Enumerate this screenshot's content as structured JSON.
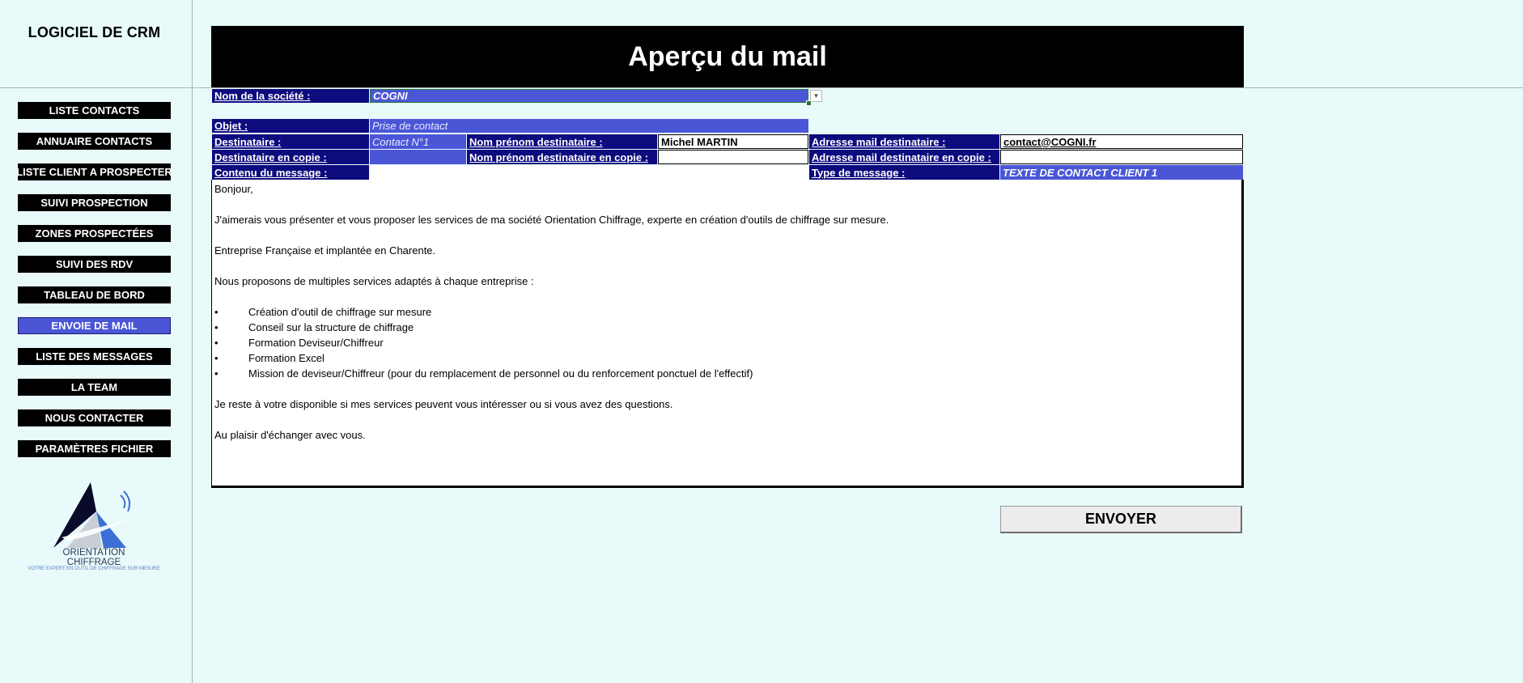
{
  "sidebar": {
    "title": "LOGICIEL DE CRM",
    "items": [
      {
        "label": "LISTE CONTACTS"
      },
      {
        "label": "ANNUAIRE CONTACTS"
      },
      {
        "label": "LISTE CLIENT A PROSPECTER"
      },
      {
        "label": "SUIVI PROSPECTION"
      },
      {
        "label": "ZONES PROSPECTÉES"
      },
      {
        "label": "SUIVI DES RDV"
      },
      {
        "label": "TABLEAU DE BORD"
      },
      {
        "label": "ENVOIE DE MAIL"
      },
      {
        "label": "LISTE DES MESSAGES"
      },
      {
        "label": "LA TEAM"
      },
      {
        "label": "NOUS CONTACTER"
      },
      {
        "label": "PARAMÈTRES FICHIER"
      }
    ],
    "logo": {
      "line1": "ORIENTATION",
      "line2": "CHIFFRAGE",
      "tagline": "VOTRE EXPERT EN OUTIL DE CHIFFRAGE SUR MESURE"
    }
  },
  "header": {
    "title": "Aperçu du mail"
  },
  "form": {
    "company_label": "Nom de la société :",
    "company_value": "COGNI",
    "subject_label": "Objet :",
    "subject_value": "Prise de contact",
    "recipient_label": "Destinataire :",
    "recipient_value": "Contact N°1",
    "recipient_name_label": "Nom prénom destinataire :",
    "recipient_name_value": "Michel MARTIN",
    "recipient_email_label": "Adresse mail destinataire :",
    "recipient_email_value": "contact@COGNI.fr",
    "cc_label": "Destinataire en copie :",
    "cc_value": "",
    "cc_name_label": "Nom prénom destinataire en copie :",
    "cc_name_value": "",
    "cc_email_label": "Adresse mail destinataire en copie :",
    "cc_email_value": "",
    "content_label": "Contenu du message :",
    "message_type_label": "Type de message :",
    "message_type_value": "TEXTE DE CONTACT CLIENT 1"
  },
  "message": {
    "greeting": "Bonjour,",
    "intro": "J'aimerais vous présenter et vous proposer les services de ma société Orientation Chiffrage, experte en création d'outils de chiffrage sur mesure.",
    "location": "Entreprise Française et implantée en Charente.",
    "services_intro": "Nous proposons de multiples services adaptés à chaque entreprise :",
    "bullet_char": "•",
    "services": [
      "Création d'outil de chiffrage sur mesure",
      "Conseil sur la structure de chiffrage",
      "Formation Deviseur/Chiffreur",
      "Formation Excel",
      "Mission de deviseur/Chiffreur (pour du remplacement de personnel ou du renforcement ponctuel de l'effectif)"
    ],
    "closing1": "Je reste à votre disponible si mes services peuvent vous intéresser ou si vous avez des questions.",
    "closing2": "Au plaisir d'échanger avec vous."
  },
  "actions": {
    "send_label": "ENVOYER"
  },
  "colors": {
    "accent": "#4a56d6",
    "label_bg": "#0d0b7e",
    "background": "#e9fafa"
  }
}
